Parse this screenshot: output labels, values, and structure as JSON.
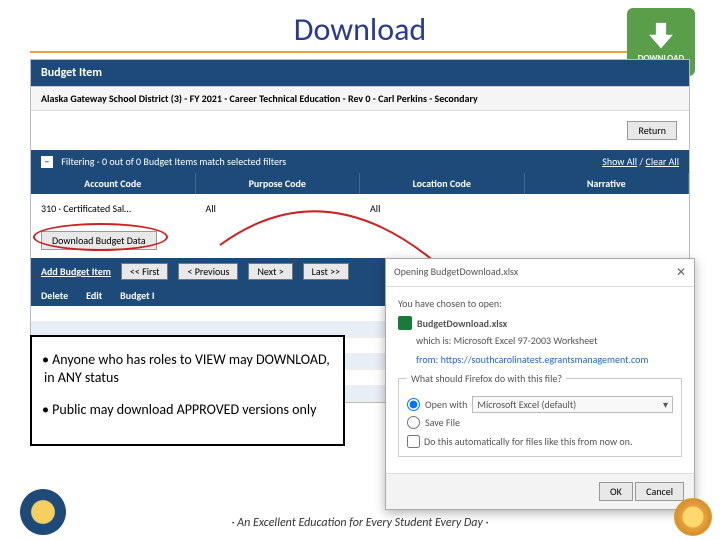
{
  "slide": {
    "title": "Download"
  },
  "badge": {
    "label": "DOWNLOAD"
  },
  "app": {
    "panel_title": "Budget Item",
    "breadcrumb": "Alaska Gateway School District (3) - FY 2021 - Career Technical Education - Rev 0 - Carl Perkins - Secondary",
    "return_btn": "Return",
    "filter": {
      "summary": "Filtering - 0 out of 0 Budget Items match selected filters",
      "show_all": "Show All",
      "clear_all": "Clear All",
      "cols": [
        "Account Code",
        "Purpose Code",
        "Location Code",
        "Narrative"
      ],
      "row": [
        "310 · Certificated Sal…",
        "All",
        "All",
        ""
      ]
    },
    "download_btn": "Download Budget Data",
    "nav": {
      "add": "Add Budget Item",
      "first": "<< First",
      "prev": "< Previous",
      "next": "Next >",
      "last": "Last >>"
    },
    "table_head": [
      "Delete",
      "Edit",
      "Budget I"
    ]
  },
  "dialog": {
    "title": "Opening BudgetDownload.xlsx",
    "chosen": "You have chosen to open:",
    "filename": "BudgetDownload.xlsx",
    "which": "which is: Microsoft Excel 97-2003 Worksheet",
    "from": "from: https://southcarolinatest.egrantsmanagement.com",
    "legend": "What should Firefox do with this file?",
    "open_with": "Open with",
    "open_val": "Microsoft Excel (default)",
    "save": "Save File",
    "auto": "Do this automatically for files like this from now on.",
    "ok": "OK",
    "cancel": "Cancel"
  },
  "callout": {
    "b1": "Anyone who has roles to  VIEW may DOWNLOAD, in ANY status",
    "b2": "Public may download APPROVED versions only"
  },
  "footer": "· An Excellent Education for Every Student Every Day ·"
}
